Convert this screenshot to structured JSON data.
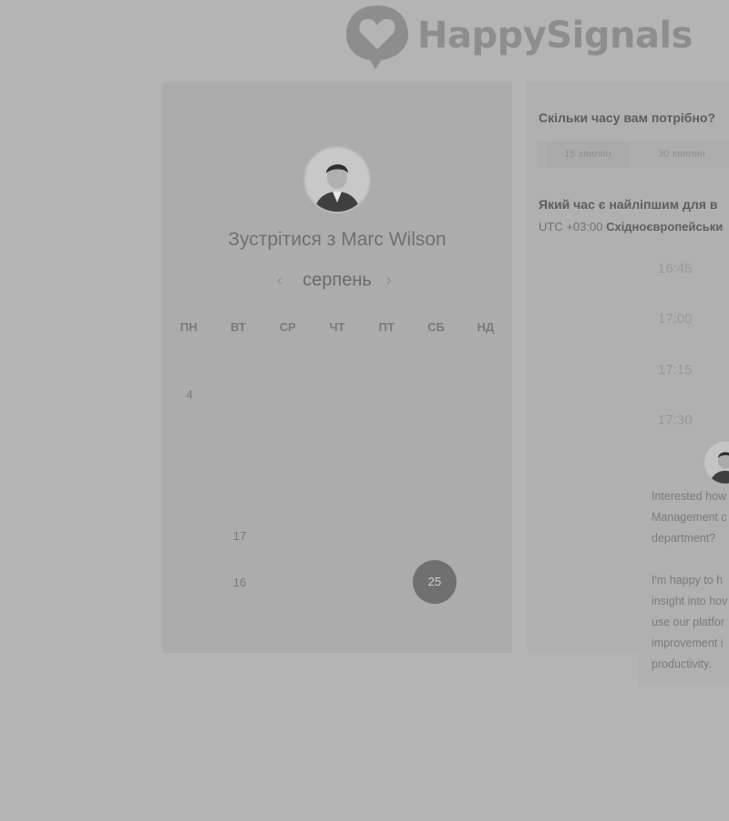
{
  "brand": {
    "name": "HappySignals"
  },
  "calendar": {
    "meet_prefix": "Зустрітися з",
    "host_name": "Marc Wilson",
    "month": "серпень",
    "weekdays": [
      "ПН",
      "ВТ",
      "СР",
      "ЧТ",
      "ПТ",
      "СБ",
      "НД"
    ],
    "days": {
      "d4": "4",
      "d17": "17",
      "d16": "16",
      "d25": "25"
    },
    "selected_day": "25"
  },
  "booking": {
    "duration_question": "Скільки часу вам потрібно?",
    "durations": [
      "15 хвилин",
      "30 хвилин"
    ],
    "time_question": "Який час є найліпшим для в",
    "timezone_offset": "UTC +03:00",
    "timezone_name": "Східноєвропейськи",
    "slots": [
      "16:45",
      "17:00",
      "17:15",
      "17:30"
    ]
  },
  "chat": {
    "lines_1": [
      "Interested how",
      "Management c",
      "department?"
    ],
    "lines_2": [
      "I'm happy to h",
      "insight into hov",
      "use our platfor",
      "improvement i",
      "productivity."
    ]
  },
  "colors": {
    "selected_day_bg": "#707070",
    "page_bg": "#b4b4b4"
  },
  "icons": {
    "prev": "chevron-left-icon",
    "next": "chevron-right-icon",
    "logo": "heart-speech-bubble-icon"
  }
}
